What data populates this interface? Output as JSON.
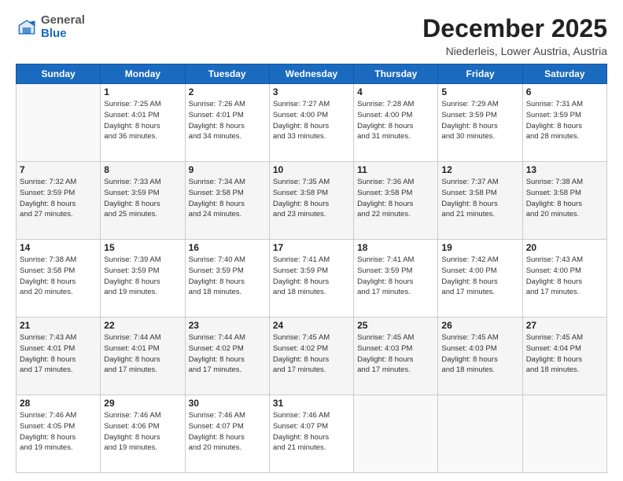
{
  "logo": {
    "general": "General",
    "blue": "Blue"
  },
  "header": {
    "month_year": "December 2025",
    "location": "Niederleis, Lower Austria, Austria"
  },
  "weekdays": [
    "Sunday",
    "Monday",
    "Tuesday",
    "Wednesday",
    "Thursday",
    "Friday",
    "Saturday"
  ],
  "weeks": [
    [
      {
        "day": "",
        "detail": ""
      },
      {
        "day": "1",
        "detail": "Sunrise: 7:25 AM\nSunset: 4:01 PM\nDaylight: 8 hours\nand 36 minutes."
      },
      {
        "day": "2",
        "detail": "Sunrise: 7:26 AM\nSunset: 4:01 PM\nDaylight: 8 hours\nand 34 minutes."
      },
      {
        "day": "3",
        "detail": "Sunrise: 7:27 AM\nSunset: 4:00 PM\nDaylight: 8 hours\nand 33 minutes."
      },
      {
        "day": "4",
        "detail": "Sunrise: 7:28 AM\nSunset: 4:00 PM\nDaylight: 8 hours\nand 31 minutes."
      },
      {
        "day": "5",
        "detail": "Sunrise: 7:29 AM\nSunset: 3:59 PM\nDaylight: 8 hours\nand 30 minutes."
      },
      {
        "day": "6",
        "detail": "Sunrise: 7:31 AM\nSunset: 3:59 PM\nDaylight: 8 hours\nand 28 minutes."
      }
    ],
    [
      {
        "day": "7",
        "detail": "Sunrise: 7:32 AM\nSunset: 3:59 PM\nDaylight: 8 hours\nand 27 minutes."
      },
      {
        "day": "8",
        "detail": "Sunrise: 7:33 AM\nSunset: 3:59 PM\nDaylight: 8 hours\nand 25 minutes."
      },
      {
        "day": "9",
        "detail": "Sunrise: 7:34 AM\nSunset: 3:58 PM\nDaylight: 8 hours\nand 24 minutes."
      },
      {
        "day": "10",
        "detail": "Sunrise: 7:35 AM\nSunset: 3:58 PM\nDaylight: 8 hours\nand 23 minutes."
      },
      {
        "day": "11",
        "detail": "Sunrise: 7:36 AM\nSunset: 3:58 PM\nDaylight: 8 hours\nand 22 minutes."
      },
      {
        "day": "12",
        "detail": "Sunrise: 7:37 AM\nSunset: 3:58 PM\nDaylight: 8 hours\nand 21 minutes."
      },
      {
        "day": "13",
        "detail": "Sunrise: 7:38 AM\nSunset: 3:58 PM\nDaylight: 8 hours\nand 20 minutes."
      }
    ],
    [
      {
        "day": "14",
        "detail": "Sunrise: 7:38 AM\nSunset: 3:58 PM\nDaylight: 8 hours\nand 20 minutes."
      },
      {
        "day": "15",
        "detail": "Sunrise: 7:39 AM\nSunset: 3:59 PM\nDaylight: 8 hours\nand 19 minutes."
      },
      {
        "day": "16",
        "detail": "Sunrise: 7:40 AM\nSunset: 3:59 PM\nDaylight: 8 hours\nand 18 minutes."
      },
      {
        "day": "17",
        "detail": "Sunrise: 7:41 AM\nSunset: 3:59 PM\nDaylight: 8 hours\nand 18 minutes."
      },
      {
        "day": "18",
        "detail": "Sunrise: 7:41 AM\nSunset: 3:59 PM\nDaylight: 8 hours\nand 17 minutes."
      },
      {
        "day": "19",
        "detail": "Sunrise: 7:42 AM\nSunset: 4:00 PM\nDaylight: 8 hours\nand 17 minutes."
      },
      {
        "day": "20",
        "detail": "Sunrise: 7:43 AM\nSunset: 4:00 PM\nDaylight: 8 hours\nand 17 minutes."
      }
    ],
    [
      {
        "day": "21",
        "detail": "Sunrise: 7:43 AM\nSunset: 4:01 PM\nDaylight: 8 hours\nand 17 minutes."
      },
      {
        "day": "22",
        "detail": "Sunrise: 7:44 AM\nSunset: 4:01 PM\nDaylight: 8 hours\nand 17 minutes."
      },
      {
        "day": "23",
        "detail": "Sunrise: 7:44 AM\nSunset: 4:02 PM\nDaylight: 8 hours\nand 17 minutes."
      },
      {
        "day": "24",
        "detail": "Sunrise: 7:45 AM\nSunset: 4:02 PM\nDaylight: 8 hours\nand 17 minutes."
      },
      {
        "day": "25",
        "detail": "Sunrise: 7:45 AM\nSunset: 4:03 PM\nDaylight: 8 hours\nand 17 minutes."
      },
      {
        "day": "26",
        "detail": "Sunrise: 7:45 AM\nSunset: 4:03 PM\nDaylight: 8 hours\nand 18 minutes."
      },
      {
        "day": "27",
        "detail": "Sunrise: 7:45 AM\nSunset: 4:04 PM\nDaylight: 8 hours\nand 18 minutes."
      }
    ],
    [
      {
        "day": "28",
        "detail": "Sunrise: 7:46 AM\nSunset: 4:05 PM\nDaylight: 8 hours\nand 19 minutes."
      },
      {
        "day": "29",
        "detail": "Sunrise: 7:46 AM\nSunset: 4:06 PM\nDaylight: 8 hours\nand 19 minutes."
      },
      {
        "day": "30",
        "detail": "Sunrise: 7:46 AM\nSunset: 4:07 PM\nDaylight: 8 hours\nand 20 minutes."
      },
      {
        "day": "31",
        "detail": "Sunrise: 7:46 AM\nSunset: 4:07 PM\nDaylight: 8 hours\nand 21 minutes."
      },
      {
        "day": "",
        "detail": ""
      },
      {
        "day": "",
        "detail": ""
      },
      {
        "day": "",
        "detail": ""
      }
    ]
  ]
}
